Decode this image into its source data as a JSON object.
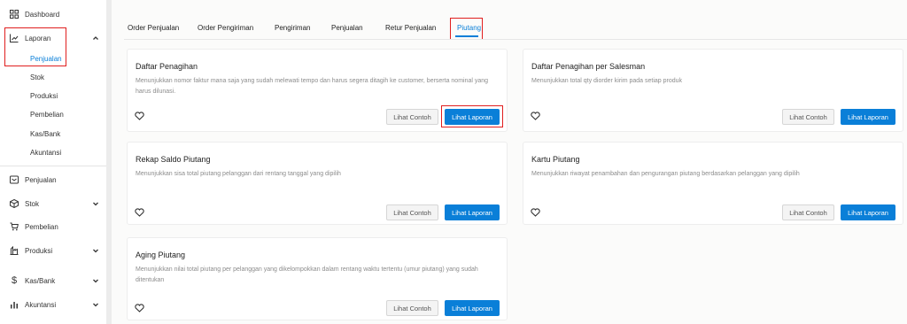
{
  "sidebar": {
    "items": [
      {
        "label": "Dashboard",
        "icon": "grid-icon"
      },
      {
        "label": "Laporan",
        "icon": "chart-line-icon"
      },
      {
        "label": "Penjualan",
        "icon": "receipt-icon"
      },
      {
        "label": "Stok",
        "icon": "box-icon"
      },
      {
        "label": "Pembelian",
        "icon": "cart-icon"
      },
      {
        "label": "Produksi",
        "icon": "factory-icon"
      },
      {
        "label": "Kas/Bank",
        "icon": "dollar-icon"
      },
      {
        "label": "Akuntansi",
        "icon": "bar-chart-icon"
      }
    ],
    "laporan_sub": [
      "Penjualan",
      "Stok",
      "Produksi",
      "Pembelian",
      "Kas/Bank",
      "Akuntansi"
    ]
  },
  "tabs": [
    "Order Penjualan",
    "Order Pengiriman",
    "Pengiriman",
    "Penjualan",
    "Retur Penjualan",
    "Piutang"
  ],
  "active_tab": "Piutang",
  "buttons": {
    "sample": "Lihat Contoh",
    "report": "Lihat Laporan"
  },
  "cards": [
    {
      "title": "Daftar Penagihan",
      "desc1": "Menunjukkan nomor faktur mana saja yang sudah melewati tempo dan harus segera ditagih ke customer, berserta nominal yang",
      "desc2": "harus dilunasi."
    },
    {
      "title": "Daftar Penagihan per Salesman",
      "desc1": "Menunjukkan total qty diorder kirim pada setiap produk",
      "desc2": ""
    },
    {
      "title": "Rekap Saldo Piutang",
      "desc1": "Menunjukkan sisa total piutang pelanggan dari rentang tanggal yang dipilih",
      "desc2": ""
    },
    {
      "title": "Kartu Piutang",
      "desc1": "Menunjukkan riwayat penambahan dan pengurangan piutang berdasarkan pelanggan yang dipilih",
      "desc2": ""
    },
    {
      "title": "Aging Piutang",
      "desc1": "Menunjukkan nilai total piutang per pelanggan yang dikelompokkan dalam rentang waktu tertentu (umur piutang) yang sudah",
      "desc2": "ditentukan"
    }
  ],
  "colors": {
    "accent": "#0a7fd8",
    "highlight": "#e01e1e"
  }
}
